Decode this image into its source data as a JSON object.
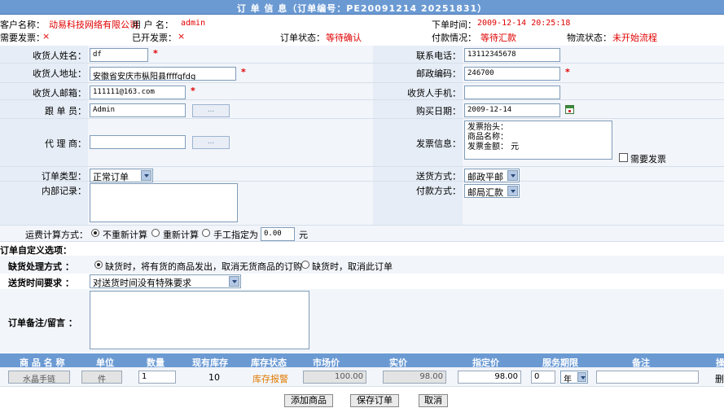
{
  "header": {
    "title": "订 单 信 息（订单编号：PE20091214 20251831）"
  },
  "info": {
    "customer_label": "客户名称：",
    "customer_value": "动易科技网络有限公司",
    "user_label": "用 户 名：",
    "user_value": "admin",
    "order_time_label": "下单时间：",
    "order_time_value": "2009-12-14 20:25:18",
    "invoice_need_label": "需要发票：",
    "invoice_need_value": "×",
    "invoice_issued_label": "已开发票：",
    "invoice_issued_value": "×",
    "order_status_label": "订单状态：",
    "order_status_value": "等待确认",
    "payment_label": "付款情况：",
    "payment_value": "等待汇款",
    "logistics_label": "物流状态：",
    "logistics_value": "未开始流程"
  },
  "form": {
    "receiver_name_label": "收货人姓名：",
    "receiver_name_value": "df",
    "phone_label": "联系电话：",
    "phone_value": "13112345678",
    "address_label": "收货人地址：",
    "address_value": "安徽省安庆市枞阳县ffffgfdg",
    "zip_label": "邮政编码：",
    "zip_value": "246700",
    "email_label": "收货人邮箱：",
    "email_value": "111111@163.com",
    "mobile_label": "收货人手机：",
    "mobile_value": "",
    "follower_label": "跟 单 员：",
    "follower_value": "Admin",
    "dots": "...",
    "buy_date_label": "购买日期：",
    "buy_date_value": "2009-12-14",
    "agent_label": "代 理 商：",
    "agent_value": "",
    "invoice_info_label": "发票信息：",
    "invoice_info_lines": [
      "发票抬头：",
      "商品名称：",
      "发票金额： 元"
    ],
    "need_invoice_label": "需要发票",
    "order_type_label": "订单类型：",
    "order_type_value": "正常订单",
    "delivery_label": "送货方式：",
    "delivery_value": "邮政平邮",
    "internal_label": "内部记录：",
    "pay_method_label": "付款方式：",
    "pay_method_value": "邮局汇款",
    "freight_label": "运费计算方式：",
    "freight_opt1": "不重新计算",
    "freight_opt2": "重新计算",
    "freight_opt3": "手工指定为",
    "freight_value": "0.00",
    "freight_unit": "元"
  },
  "custom": {
    "section_title": "订单自定义选项：",
    "stockout_label": "缺货处理方式 ：",
    "stockout_opt1": "缺货时，将有货的商品发出，取消无货商品的订购",
    "stockout_opt2": "缺货时，取消此订单",
    "delivery_time_label": "送货时间要求 ：",
    "delivery_time_value": "对送货时间没有特殊要求",
    "remark_label": "订单备注/留言 ："
  },
  "table": {
    "headers": [
      "商 品 名 称",
      "单位",
      "数量",
      "现有库存",
      "库存状态",
      "市场价",
      "实价",
      "指定价",
      "服务期限",
      "备注",
      "操"
    ],
    "row": {
      "name": "水晶手链",
      "unit": "件",
      "qty": "1",
      "stock": "10",
      "stock_status": "库存报警",
      "market_price": "100.00",
      "real_price": "98.00",
      "set_price": "98.00",
      "service": "0",
      "service_unit": "年",
      "note": "",
      "op": "删"
    }
  },
  "footer": {
    "add": "添加商品",
    "save": "保存订单",
    "cancel": "取消"
  },
  "colors": {
    "header": "#6b9ad3",
    "accent_red": "#e00000",
    "stock_warn": "#e07a00"
  }
}
